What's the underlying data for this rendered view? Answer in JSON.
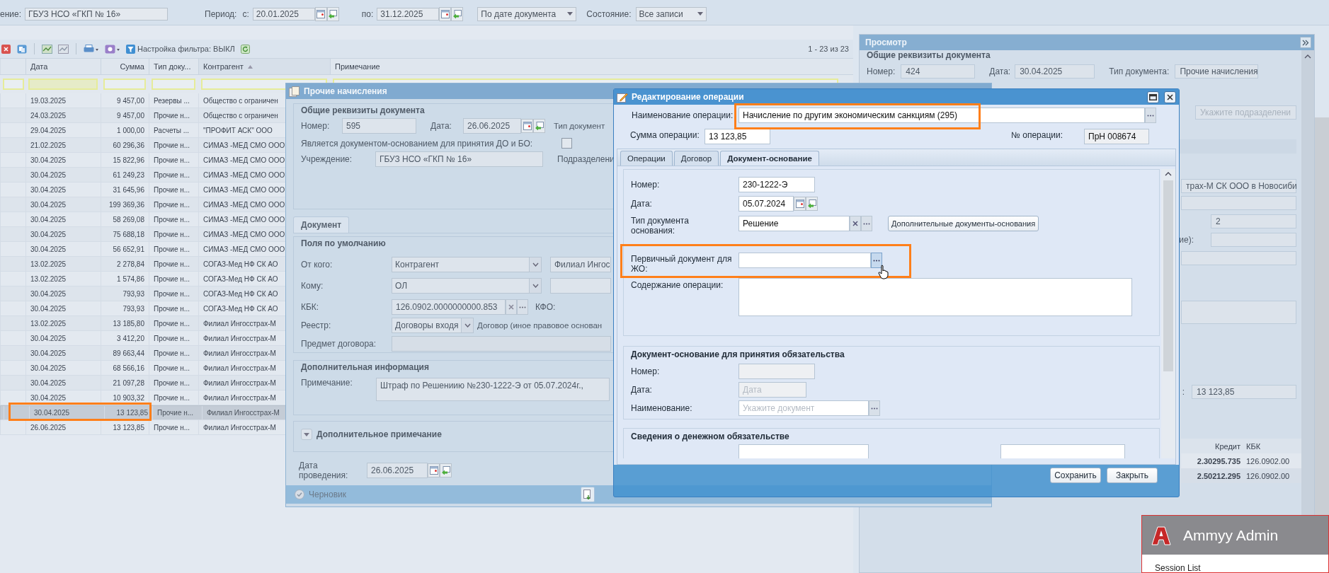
{
  "filter_bar": {
    "institution_label": "ение:",
    "institution": "ГБУЗ НСО «ГКП № 16»",
    "period_label": "Период:",
    "from_label": "с:",
    "from": "20.01.2025",
    "to_label": "по:",
    "to": "31.12.2025",
    "date_mode": "По дате документа",
    "state_label": "Состояние:",
    "state": "Все записи"
  },
  "toolbar": {
    "filter_setting": "Настройка фильтра: ВЫКЛ",
    "paging": "1 - 23 из 23"
  },
  "grid": {
    "columns": [
      {
        "label": "Дата",
        "sorted": false
      },
      {
        "label": "Сумма",
        "sorted": false
      },
      {
        "label": "Тип доку...",
        "sorted": false
      },
      {
        "label": "Контрагент",
        "sorted": true
      },
      {
        "label": "Примечание",
        "sorted": false
      }
    ],
    "rows": [
      {
        "date": "19.03.2025",
        "sum": "9 457,00",
        "type": "Резервы ...",
        "counterparty": "Общество с ограничен",
        "selected": false
      },
      {
        "date": "24.03.2025",
        "sum": "9 457,00",
        "type": "Прочие н...",
        "counterparty": "Общество с ограничен",
        "selected": false
      },
      {
        "date": "29.04.2025",
        "sum": "1 000,00",
        "type": "Расчеты ...",
        "counterparty": "\"ПРОФИТ АСК\" ООО",
        "selected": false
      },
      {
        "date": "21.02.2025",
        "sum": "60 296,36",
        "type": "Прочие н...",
        "counterparty": "СИМАЗ -МЕД СМО ООО",
        "selected": false
      },
      {
        "date": "30.04.2025",
        "sum": "15 822,96",
        "type": "Прочие н...",
        "counterparty": "СИМАЗ -МЕД СМО ООО",
        "selected": false
      },
      {
        "date": "30.04.2025",
        "sum": "61 249,23",
        "type": "Прочие н...",
        "counterparty": "СИМАЗ -МЕД СМО ООО",
        "selected": false
      },
      {
        "date": "30.04.2025",
        "sum": "31 645,96",
        "type": "Прочие н...",
        "counterparty": "СИМАЗ -МЕД СМО ООО",
        "selected": false
      },
      {
        "date": "30.04.2025",
        "sum": "199 369,36",
        "type": "Прочие н...",
        "counterparty": "СИМАЗ -МЕД СМО ООО",
        "selected": false
      },
      {
        "date": "30.04.2025",
        "sum": "58 269,08",
        "type": "Прочие н...",
        "counterparty": "СИМАЗ -МЕД СМО ООО",
        "selected": false
      },
      {
        "date": "30.04.2025",
        "sum": "75 688,18",
        "type": "Прочие н...",
        "counterparty": "СИМАЗ -МЕД СМО ООО",
        "selected": false
      },
      {
        "date": "30.04.2025",
        "sum": "56 652,91",
        "type": "Прочие н...",
        "counterparty": "СИМАЗ -МЕД СМО ООО",
        "selected": false
      },
      {
        "date": "13.02.2025",
        "sum": "2 278,84",
        "type": "Прочие н...",
        "counterparty": "СОГАЗ-Мед НФ СК АО",
        "selected": false
      },
      {
        "date": "13.02.2025",
        "sum": "1 574,86",
        "type": "Прочие н...",
        "counterparty": "СОГАЗ-Мед НФ СК АО",
        "selected": false
      },
      {
        "date": "30.04.2025",
        "sum": "793,93",
        "type": "Прочие н...",
        "counterparty": "СОГАЗ-Мед НФ СК АО",
        "selected": false
      },
      {
        "date": "30.04.2025",
        "sum": "793,93",
        "type": "Прочие н...",
        "counterparty": "СОГАЗ-Мед НФ СК АО",
        "selected": false
      },
      {
        "date": "13.02.2025",
        "sum": "13 185,80",
        "type": "Прочие н...",
        "counterparty": "Филиал Ингосстрах-М",
        "selected": false
      },
      {
        "date": "30.04.2025",
        "sum": "3 412,20",
        "type": "Прочие н...",
        "counterparty": "Филиал Ингосстрах-М",
        "selected": false
      },
      {
        "date": "30.04.2025",
        "sum": "89 663,44",
        "type": "Прочие н...",
        "counterparty": "Филиал Ингосстрах-М",
        "selected": false
      },
      {
        "date": "30.04.2025",
        "sum": "68 566,16",
        "type": "Прочие н...",
        "counterparty": "Филиал Ингосстрах-М",
        "selected": false
      },
      {
        "date": "30.04.2025",
        "sum": "21 097,28",
        "type": "Прочие н...",
        "counterparty": "Филиал Ингосстрах-М",
        "selected": false
      },
      {
        "date": "30.04.2025",
        "sum": "10 903,32",
        "type": "Прочие н...",
        "counterparty": "Филиал Ингосстрах-М",
        "selected": false
      },
      {
        "date": "30.04.2025",
        "sum": "13 123,85",
        "type": "Прочие н...",
        "counterparty": "Филиал Ингосстрах-М",
        "selected": true
      },
      {
        "date": "26.06.2025",
        "sum": "13 123,85",
        "type": "Прочие н...",
        "counterparty": "Филиал Ингосстрах-М",
        "selected": false
      }
    ]
  },
  "document_dialog": {
    "title": "Прочие начисления",
    "general": {
      "legend": "Общие реквизиты документа",
      "number_label": "Номер:",
      "number": "595",
      "date_label": "Дата:",
      "date": "26.06.2025",
      "doc_type_label": "Тип документ",
      "basis_label": "Является документом-основанием для принятия ДО и БО:",
      "basis_checked": false,
      "institution_label": "Учреждение:",
      "institution": "ГБУЗ НСО «ГКП № 16»",
      "subdivision_label": "Подразделени"
    },
    "tabs": [
      {
        "label": "Документ",
        "selected": true
      }
    ],
    "defaults": {
      "legend": "Поля по умолчанию",
      "from_label": "От кого:",
      "from_kind": "Контрагент",
      "from_value": "Филиал Ингос",
      "to_label": "Кому:",
      "to_kind": "ОЛ",
      "kbk_label": "КБК:",
      "kbk": "126.0902.0000000000.853",
      "kfo_label": "КФО:",
      "registry_label": "Реестр:",
      "registry": "Договоры входя",
      "contract_type": "Договор (иное правовое основан",
      "subject_label": "Предмет договора:"
    },
    "extra": {
      "legend": "Дополнительная информация",
      "note_label": "Примечание:",
      "note": "Штраф по Решениию №230-1222-Э от 05.07.2024г.,"
    },
    "extra_note": {
      "legend": "Дополнительное примечание",
      "expanded": false
    },
    "posting_date_label": "Дата проведения:",
    "posting_date": "26.06.2025",
    "status": "Черновик"
  },
  "operation_dialog": {
    "title": "Редактирование операции",
    "name_label": "Наименование операции:",
    "name": "Начисление по другим экономическим санкциям (295)",
    "sum_label": "Сумма операции:",
    "sum": "13 123,85",
    "op_number_label": "№ операции:",
    "op_number": "ПрН 008674",
    "tabs": [
      {
        "label": "Операции",
        "selected": false
      },
      {
        "label": "Договор",
        "selected": false
      },
      {
        "label": "Документ-основание",
        "selected": true
      }
    ],
    "basis": {
      "number_label": "Номер:",
      "number": "230-1222-Э",
      "date_label": "Дата:",
      "date": "05.07.2024",
      "type_label": "Тип документа основания:",
      "type": "Решение",
      "extra_button": "Дополнительные документы-основания",
      "primary_label": "Первичный документ для ЖО:",
      "content_label": "Содержание операции:"
    },
    "obligation": {
      "legend": "Документ-основание для принятия обязательства",
      "number_label": "Номер:",
      "date_label": "Дата:",
      "date_placeholder": "Дата",
      "name_label": "Наименование:",
      "name_placeholder": "Укажите документ"
    },
    "money": {
      "legend": "Сведения о денежном обязательстве"
    },
    "buttons": [
      "Сохранить",
      "Закрыть"
    ]
  },
  "preview_panel": {
    "title": "Просмотр",
    "legend": "Общие реквизиты документа",
    "number_label": "Номер:",
    "number": "424",
    "date_label": "Дата:",
    "date": "30.04.2025",
    "type_label": "Тип документа:",
    "type": "Прочие начисления",
    "subdivision_placeholder": "Укажите подразделени",
    "counterparty": "трах-М СК ООО в Новосиби",
    "count": "2",
    "count2_label": "ие):",
    "amount_label": ":",
    "amount": "13 123,85",
    "entries": {
      "columns": [
        "Кредит",
        "КБК"
      ],
      "rows": [
        [
          "2.30295.735",
          "126.0902.00"
        ],
        [
          "2.50212.295",
          "126.0902.00"
        ]
      ]
    }
  },
  "remote_popup": {
    "title": "Ammyy Admin",
    "item": "Session List"
  }
}
